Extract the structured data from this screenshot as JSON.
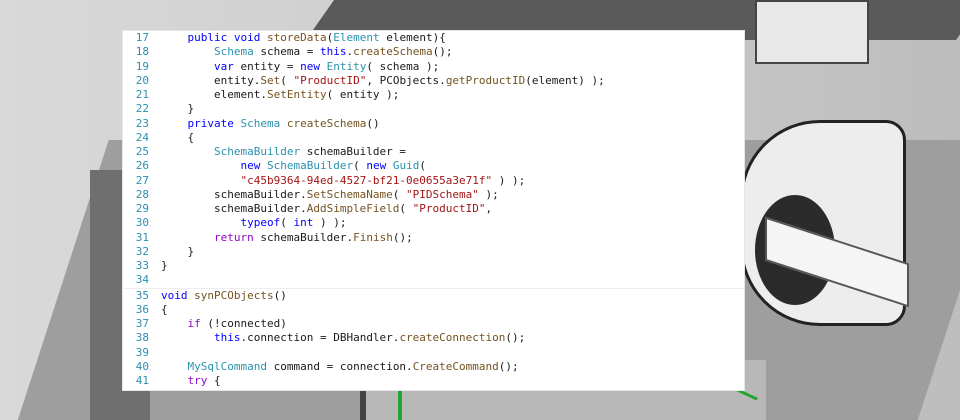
{
  "colors": {
    "keyword": "#0000ff",
    "control_keyword": "#8f08c4",
    "type": "#2b91af",
    "method": "#74531f",
    "string": "#a31515",
    "line_number": "#2b91af"
  },
  "code": {
    "lines": [
      {
        "n": "17",
        "tokens": [
          {
            "t": "    "
          },
          {
            "t": "public",
            "c": "kw"
          },
          {
            "t": " "
          },
          {
            "t": "void",
            "c": "kw"
          },
          {
            "t": " "
          },
          {
            "t": "storeData",
            "c": "fn"
          },
          {
            "t": "("
          },
          {
            "t": "Element",
            "c": "ty"
          },
          {
            "t": " element){"
          }
        ]
      },
      {
        "n": "18",
        "tokens": [
          {
            "t": "        "
          },
          {
            "t": "Schema",
            "c": "ty"
          },
          {
            "t": " schema = "
          },
          {
            "t": "this",
            "c": "kw"
          },
          {
            "t": "."
          },
          {
            "t": "createSchema",
            "c": "fn"
          },
          {
            "t": "();"
          }
        ]
      },
      {
        "n": "19",
        "tokens": [
          {
            "t": "        "
          },
          {
            "t": "var",
            "c": "kw"
          },
          {
            "t": " entity = "
          },
          {
            "t": "new",
            "c": "kw"
          },
          {
            "t": " "
          },
          {
            "t": "Entity",
            "c": "ty"
          },
          {
            "t": "( schema );"
          }
        ]
      },
      {
        "n": "20",
        "tokens": [
          {
            "t": "        entity."
          },
          {
            "t": "Set",
            "c": "fn"
          },
          {
            "t": "( "
          },
          {
            "t": "\"ProductID\"",
            "c": "str"
          },
          {
            "t": ", PCObjects."
          },
          {
            "t": "getProductID",
            "c": "fn"
          },
          {
            "t": "(element) );"
          }
        ]
      },
      {
        "n": "21",
        "tokens": [
          {
            "t": "        element."
          },
          {
            "t": "SetEntity",
            "c": "fn"
          },
          {
            "t": "( entity );"
          }
        ]
      },
      {
        "n": "22",
        "tokens": [
          {
            "t": "    }"
          }
        ]
      },
      {
        "n": "23",
        "tokens": [
          {
            "t": "    "
          },
          {
            "t": "private",
            "c": "kw"
          },
          {
            "t": " "
          },
          {
            "t": "Schema",
            "c": "ty"
          },
          {
            "t": " "
          },
          {
            "t": "createSchema",
            "c": "fn"
          },
          {
            "t": "()"
          }
        ]
      },
      {
        "n": "24",
        "tokens": [
          {
            "t": "    {"
          }
        ]
      },
      {
        "n": "25",
        "tokens": [
          {
            "t": "        "
          },
          {
            "t": "SchemaBuilder",
            "c": "ty"
          },
          {
            "t": " schemaBuilder ="
          }
        ]
      },
      {
        "n": "26",
        "tokens": [
          {
            "t": "            "
          },
          {
            "t": "new",
            "c": "kw"
          },
          {
            "t": " "
          },
          {
            "t": "SchemaBuilder",
            "c": "ty"
          },
          {
            "t": "( "
          },
          {
            "t": "new",
            "c": "kw"
          },
          {
            "t": " "
          },
          {
            "t": "Guid",
            "c": "ty"
          },
          {
            "t": "("
          }
        ]
      },
      {
        "n": "27",
        "tokens": [
          {
            "t": "            "
          },
          {
            "t": "\"c45b9364-94ed-4527-bf21-0e0655a3e71f\"",
            "c": "str"
          },
          {
            "t": " ) );"
          }
        ]
      },
      {
        "n": "28",
        "tokens": [
          {
            "t": "        schemaBuilder."
          },
          {
            "t": "SetSchemaName",
            "c": "fn"
          },
          {
            "t": "( "
          },
          {
            "t": "\"PIDSchema\"",
            "c": "str"
          },
          {
            "t": " );"
          }
        ]
      },
      {
        "n": "29",
        "tokens": [
          {
            "t": "        schemaBuilder."
          },
          {
            "t": "AddSimpleField",
            "c": "fn"
          },
          {
            "t": "( "
          },
          {
            "t": "\"ProductID\"",
            "c": "str"
          },
          {
            "t": ","
          }
        ]
      },
      {
        "n": "30",
        "tokens": [
          {
            "t": "            "
          },
          {
            "t": "typeof",
            "c": "kw"
          },
          {
            "t": "( "
          },
          {
            "t": "int",
            "c": "kw"
          },
          {
            "t": " ) );"
          }
        ]
      },
      {
        "n": "31",
        "tokens": [
          {
            "t": "        "
          },
          {
            "t": "return",
            "c": "kw2"
          },
          {
            "t": " schemaBuilder."
          },
          {
            "t": "Finish",
            "c": "fn"
          },
          {
            "t": "();"
          }
        ]
      },
      {
        "n": "32",
        "tokens": [
          {
            "t": "    }"
          }
        ]
      },
      {
        "n": "33",
        "tokens": [
          {
            "t": "}"
          }
        ]
      },
      {
        "n": "34",
        "tokens": [
          {
            "t": ""
          }
        ]
      },
      {
        "n": "35",
        "tokens": [
          {
            "t": "void",
            "c": "kw"
          },
          {
            "t": " "
          },
          {
            "t": "synPCObjects",
            "c": "fn"
          },
          {
            "t": "()"
          }
        ]
      },
      {
        "n": "36",
        "tokens": [
          {
            "t": "{"
          }
        ]
      },
      {
        "n": "37",
        "tokens": [
          {
            "t": "    "
          },
          {
            "t": "if",
            "c": "kw2"
          },
          {
            "t": " (!connected)"
          }
        ]
      },
      {
        "n": "38",
        "tokens": [
          {
            "t": "        "
          },
          {
            "t": "this",
            "c": "kw"
          },
          {
            "t": ".connection = DBHandler."
          },
          {
            "t": "createConnection",
            "c": "fn"
          },
          {
            "t": "();"
          }
        ]
      },
      {
        "n": "39",
        "tokens": [
          {
            "t": ""
          }
        ]
      },
      {
        "n": "40",
        "tokens": [
          {
            "t": "    "
          },
          {
            "t": "MySqlCommand",
            "c": "ty"
          },
          {
            "t": " command = connection."
          },
          {
            "t": "CreateCommand",
            "c": "fn"
          },
          {
            "t": "();"
          }
        ]
      },
      {
        "n": "41",
        "tokens": [
          {
            "t": "    "
          },
          {
            "t": "try",
            "c": "kw2"
          },
          {
            "t": " {"
          }
        ]
      }
    ]
  }
}
